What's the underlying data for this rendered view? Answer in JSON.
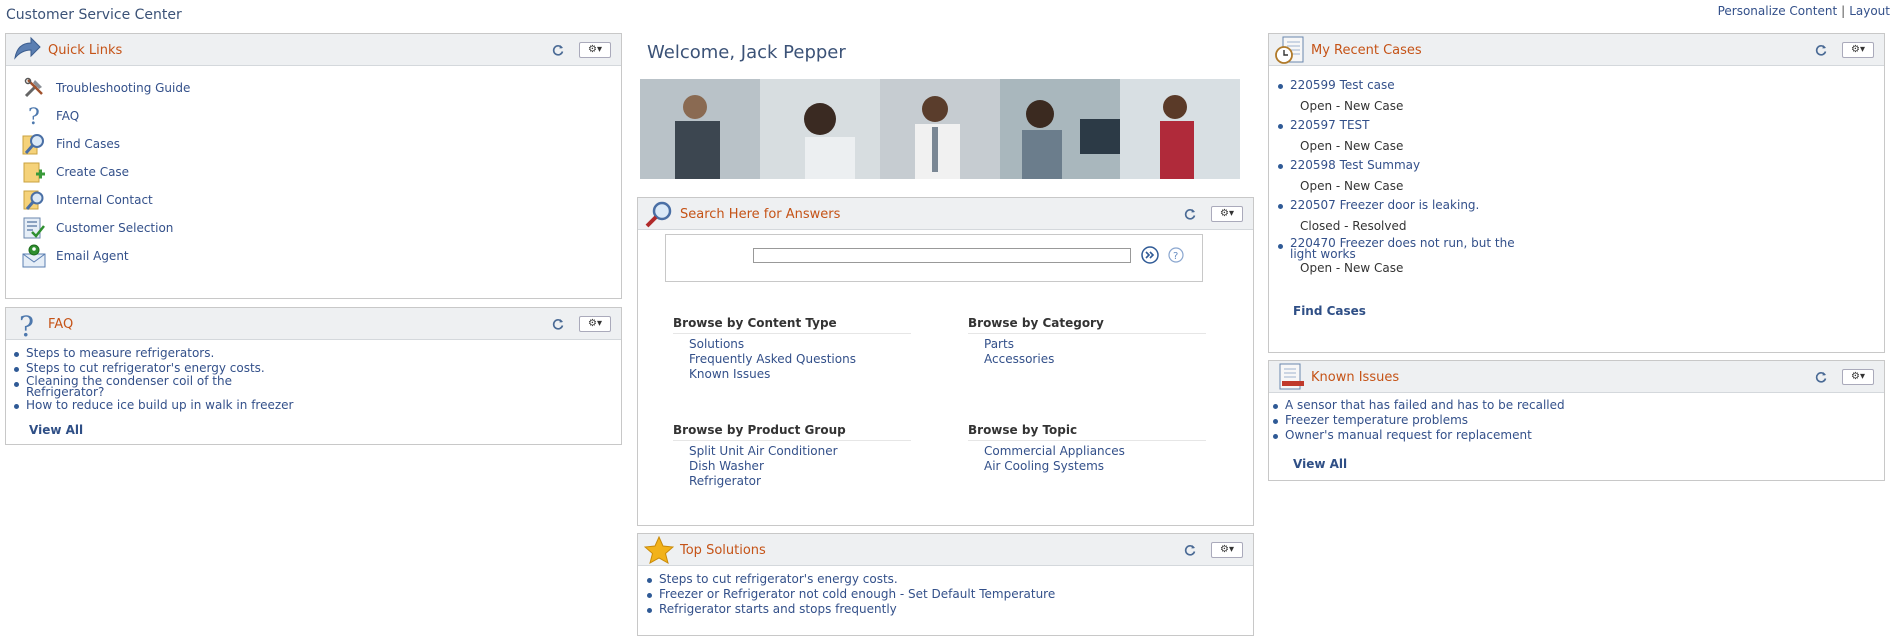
{
  "app": {
    "title": "Customer Service Center",
    "personalize_label": "Personalize Content",
    "layout_label": "Layout"
  },
  "quick_links": {
    "title": "Quick Links",
    "items": [
      {
        "label": "Troubleshooting Guide",
        "icon": "tools-icon"
      },
      {
        "label": "FAQ",
        "icon": "question-icon"
      },
      {
        "label": "Find Cases",
        "icon": "magnifier-icon"
      },
      {
        "label": "Create Case",
        "icon": "create-case-icon"
      },
      {
        "label": "Internal Contact",
        "icon": "contact-search-icon"
      },
      {
        "label": "Customer Selection",
        "icon": "customer-selection-icon"
      },
      {
        "label": "Email Agent",
        "icon": "email-agent-icon"
      }
    ]
  },
  "faq": {
    "title": "FAQ",
    "items": [
      "Steps to measure refrigerators.",
      "Steps to cut refrigerator's energy costs.",
      "Cleaning the condenser coil of the Refrigerator?",
      "How to reduce ice build up in walk in freezer"
    ],
    "view_all": "View All"
  },
  "welcome": {
    "text": "Welcome, Jack Pepper"
  },
  "search": {
    "title": "Search Here for Answers",
    "input_value": "",
    "browse": {
      "content_type": {
        "heading": "Browse by Content Type",
        "items": [
          "Solutions",
          "Frequently Asked Questions",
          "Known Issues"
        ]
      },
      "category": {
        "heading": "Browse by Category",
        "items": [
          "Parts",
          "Accessories"
        ]
      },
      "product_group": {
        "heading": "Browse by Product Group",
        "items": [
          "Split Unit Air Conditioner",
          "Dish Washer",
          "Refrigerator"
        ]
      },
      "topic": {
        "heading": "Browse by Topic",
        "items": [
          "Commercial Appliances",
          "Air Cooling Systems"
        ]
      }
    }
  },
  "top_solutions": {
    "title": "Top Solutions",
    "items": [
      "Steps to cut refrigerator's energy costs.",
      "Freezer or Refrigerator not cold enough - Set Default Temperature",
      "Refrigerator starts and stops frequently"
    ]
  },
  "recent_cases": {
    "title": "My Recent Cases",
    "cases": [
      {
        "link": "220599 Test case",
        "status": "Open - New Case"
      },
      {
        "link": "220597 TEST",
        "status": "Open - New Case"
      },
      {
        "link": "220598 Test Summay",
        "status": "Open - New Case"
      },
      {
        "link": "220507 Freezer door is leaking.",
        "status": "Closed - Resolved"
      },
      {
        "link": "220470 Freezer does not run, but the light works",
        "status": "Open - New Case"
      }
    ],
    "find_cases": "Find Cases"
  },
  "known_issues": {
    "title": "Known Issues",
    "items": [
      "A sensor that has failed and has to be recalled",
      "Freezer temperature problems",
      "Owner's manual request for replacement"
    ],
    "view_all": "View All"
  },
  "colors": {
    "title_orange": "#c55317",
    "link_blue": "#33508a",
    "header_bg": "#eef0f2",
    "bullet_blue": "#2f5a96"
  }
}
